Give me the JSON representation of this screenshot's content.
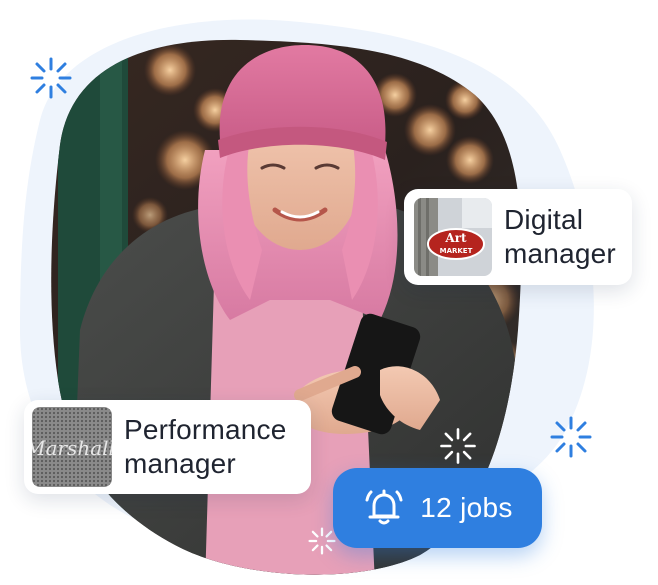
{
  "colors": {
    "accent": "#2f7fe0",
    "backdrop_blob": "#eef4fc",
    "card_text": "#1f2430",
    "sparkle_blue": "#2f7fe0"
  },
  "cards": {
    "digital": {
      "title": "Digital manager",
      "line1": "Digital",
      "line2": "manager",
      "thumb_text": "Art MARKET",
      "thumb_line1": "Art",
      "thumb_line2": "MARKET"
    },
    "performance": {
      "title": "Performance manager",
      "line1": "Performance",
      "line2": "manager",
      "thumb_text": "Marshall"
    }
  },
  "jobs_badge": {
    "icon": "bell-icon",
    "label": "12 jobs"
  },
  "photo": {
    "subject": "woman-with-pink-hair-using-phone"
  },
  "decorations": {
    "sparkle_icon": "sparkle-icon"
  }
}
